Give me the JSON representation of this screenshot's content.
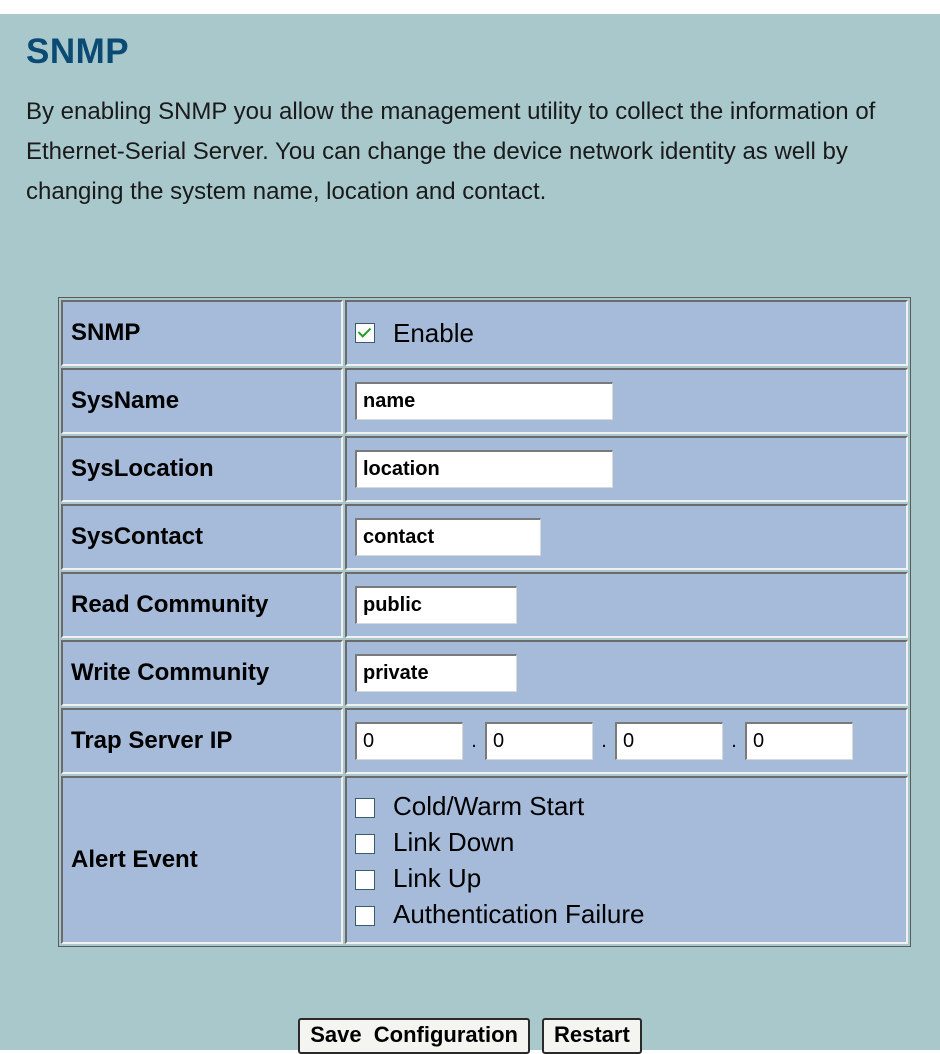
{
  "page": {
    "title": "SNMP",
    "description": "By enabling SNMP you allow the management utility to collect the information of Ethernet-Serial Server. You can change the device network identity as well by changing the system name, location and contact."
  },
  "form": {
    "snmp": {
      "label": "SNMP",
      "checkbox_label": "Enable",
      "checked": true
    },
    "sysname": {
      "label": "SysName",
      "value": "name"
    },
    "syslocation": {
      "label": "SysLocation",
      "value": "location"
    },
    "syscontact": {
      "label": "SysContact",
      "value": "contact"
    },
    "read_community": {
      "label": "Read Community",
      "value": "public"
    },
    "write_community": {
      "label": "Write Community",
      "value": "private"
    },
    "trap_server_ip": {
      "label": "Trap Server IP",
      "octets": [
        "0",
        "0",
        "0",
        "0"
      ],
      "separator": "."
    },
    "alert_event": {
      "label": "Alert Event",
      "options": [
        {
          "label": "Cold/Warm Start",
          "checked": false
        },
        {
          "label": "Link Down",
          "checked": false
        },
        {
          "label": "Link Up",
          "checked": false
        },
        {
          "label": "Authentication Failure",
          "checked": false
        }
      ]
    }
  },
  "buttons": {
    "save": "Save  Configuration",
    "restart": "Restart"
  },
  "colors": {
    "background": "#a8c8cc",
    "cell": "#a6bbd9",
    "title": "#0b4a72",
    "check": "#21a121"
  }
}
